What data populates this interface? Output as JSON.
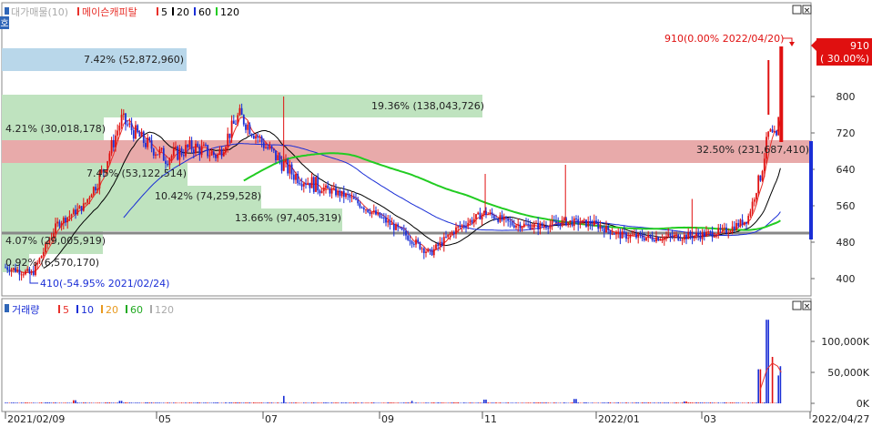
{
  "side_tab_label": "호",
  "window_buttons": [
    "□",
    "×"
  ],
  "price_panel": {
    "legend_title": "대가매물(10)",
    "legend_stock": "메이슨캐피탈",
    "ma_items": [
      {
        "label": "5",
        "color": "#e8302a"
      },
      {
        "label": "20",
        "color": "#000000"
      },
      {
        "label": "60",
        "color": "#1a2ed6"
      },
      {
        "label": "120",
        "color": "#22cc22"
      }
    ],
    "y_ticks": [
      "800",
      "720",
      "640",
      "560",
      "480",
      "400"
    ],
    "price_tag": {
      "value": "910",
      "pct": "( 30.00%)"
    },
    "annotations": {
      "high": "910(0.00% 2022/04/20)",
      "low": "410(-54.95% 2021/02/24)"
    }
  },
  "volume_profile": [
    {
      "label": "7.42% (52,872,960)",
      "color": "#b9d7ea"
    },
    {
      "label": "19.36% (138,043,726)",
      "color": "#bfe3bf"
    },
    {
      "label": "4.21% (30,018,178)",
      "color": "#bfe3bf"
    },
    {
      "label": "32.50% (231,687,410)",
      "color": "#e8aaaa"
    },
    {
      "label": "7.45% (53,122,514)",
      "color": "#bfe3bf"
    },
    {
      "label": "10.42% (74,259,528)",
      "color": "#bfe3bf"
    },
    {
      "label": "13.66% (97,405,319)",
      "color": "#bfe3bf"
    },
    {
      "label": "4.07% (29,005,919)",
      "color": "#bfe3bf"
    },
    {
      "label": "0.92% (6,570,170)",
      "color": "#bfe3bf"
    }
  ],
  "volume_panel": {
    "legend_title": "거래량",
    "ma_items": [
      {
        "label": "5",
        "color": "#e8302a"
      },
      {
        "label": "10",
        "color": "#1a2ed6"
      },
      {
        "label": "20",
        "color": "#e89a20"
      },
      {
        "label": "60",
        "color": "#22aa22"
      },
      {
        "label": "120",
        "color": "#aaaaaa"
      }
    ],
    "y_ticks": [
      "100,000K",
      "50,000K",
      "0K"
    ]
  },
  "x_axis": {
    "labels": [
      "2021/02/09",
      "05",
      "07",
      "09",
      "11",
      "2022/01",
      "03",
      "2022/04/27"
    ]
  },
  "chart_data": {
    "type": "candlestick",
    "title": "메이슨캐피탈",
    "y_axis_price": {
      "range": [
        380,
        940
      ],
      "ticks": [
        400,
        480,
        560,
        640,
        720,
        800
      ]
    },
    "y_axis_volume": {
      "range": [
        0,
        140000
      ],
      "unit": "K",
      "ticks": [
        0,
        50000,
        100000
      ]
    },
    "current_price": 910,
    "current_change_pct": 30.0,
    "high": {
      "price": 910,
      "date": "2022/04/20",
      "pct": 0.0
    },
    "low": {
      "price": 410,
      "date": "2021/02/24",
      "pct": -54.95
    },
    "reference_price": 500,
    "price_series": [
      {
        "x": "2021/02/09",
        "close": 425
      },
      {
        "x": "2021/02/24",
        "close": 410
      },
      {
        "x": "2021/03/10",
        "close": 520
      },
      {
        "x": "2021/03/25",
        "close": 560
      },
      {
        "x": "2021/04/05",
        "close": 640
      },
      {
        "x": "2021/04/15",
        "close": 750
      },
      {
        "x": "2021/04/28",
        "close": 700
      },
      {
        "x": "2021/05/10",
        "close": 665
      },
      {
        "x": "2021/05/25",
        "close": 690
      },
      {
        "x": "2021/06/08",
        "close": 670
      },
      {
        "x": "2021/06/20",
        "close": 760
      },
      {
        "x": "2021/07/05",
        "close": 690
      },
      {
        "x": "2021/07/20",
        "close": 630
      },
      {
        "x": "2021/08/05",
        "close": 600
      },
      {
        "x": "2021/08/20",
        "close": 580
      },
      {
        "x": "2021/09/05",
        "close": 540
      },
      {
        "x": "2021/09/20",
        "close": 500
      },
      {
        "x": "2021/10/05",
        "close": 455
      },
      {
        "x": "2021/10/20",
        "close": 510
      },
      {
        "x": "2021/11/05",
        "close": 545
      },
      {
        "x": "2021/11/20",
        "close": 520
      },
      {
        "x": "2021/12/05",
        "close": 515
      },
      {
        "x": "2021/12/20",
        "close": 525
      },
      {
        "x": "2022/01/05",
        "close": 520
      },
      {
        "x": "2022/01/20",
        "close": 495
      },
      {
        "x": "2022/02/05",
        "close": 490
      },
      {
        "x": "2022/02/20",
        "close": 492
      },
      {
        "x": "2022/03/05",
        "close": 495
      },
      {
        "x": "2022/03/20",
        "close": 505
      },
      {
        "x": "2022/04/01",
        "close": 530
      },
      {
        "x": "2022/04/08",
        "close": 620
      },
      {
        "x": "2022/04/13",
        "close": 720
      },
      {
        "x": "2022/04/18",
        "close": 700
      },
      {
        "x": "2022/04/20",
        "close": 910
      }
    ],
    "volume_series": [
      {
        "x": "2021/03/20",
        "value": 5000
      },
      {
        "x": "2021/04/15",
        "value": 4000
      },
      {
        "x": "2021/07/15",
        "value": 12000
      },
      {
        "x": "2021/09/25",
        "value": 4000
      },
      {
        "x": "2021/11/05",
        "value": 6000
      },
      {
        "x": "2021/12/25",
        "value": 7000
      },
      {
        "x": "2022/02/25",
        "value": 3000
      },
      {
        "x": "2022/04/08",
        "value": 55000
      },
      {
        "x": "2022/04/12",
        "value": 135000
      },
      {
        "x": "2022/04/15",
        "value": 75000
      },
      {
        "x": "2022/04/19",
        "value": 45000
      },
      {
        "x": "2022/04/20",
        "value": 60000
      }
    ],
    "volume_profile_pct": [
      7.42,
      19.36,
      4.21,
      32.5,
      7.45,
      10.42,
      13.66,
      4.07,
      0.92
    ]
  }
}
